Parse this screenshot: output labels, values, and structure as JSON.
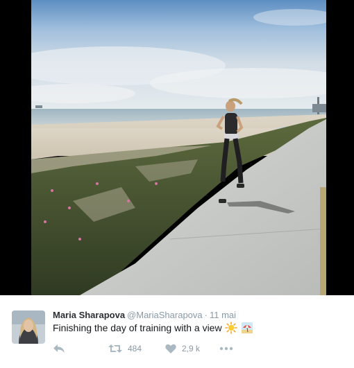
{
  "tweet": {
    "fullname": "Maria Sharapova",
    "handle": "@MariaSharapova",
    "separator": "·",
    "time": "11 mai",
    "text": "Finishing the day of training with a view",
    "emojis": [
      "sun-emoji",
      "beach-umbrella-emoji"
    ]
  },
  "actions": {
    "reply_icon": "reply-icon",
    "retweet_icon": "retweet-icon",
    "retweet_count": "484",
    "like_icon": "heart-icon",
    "like_count": "2,9 k",
    "more_icon": "more-icon"
  },
  "colors": {
    "name": "#292f33",
    "secondary": "#8899a6",
    "icon": "#aab8c2",
    "background": "#ffffff",
    "letterbox": "#000000"
  }
}
